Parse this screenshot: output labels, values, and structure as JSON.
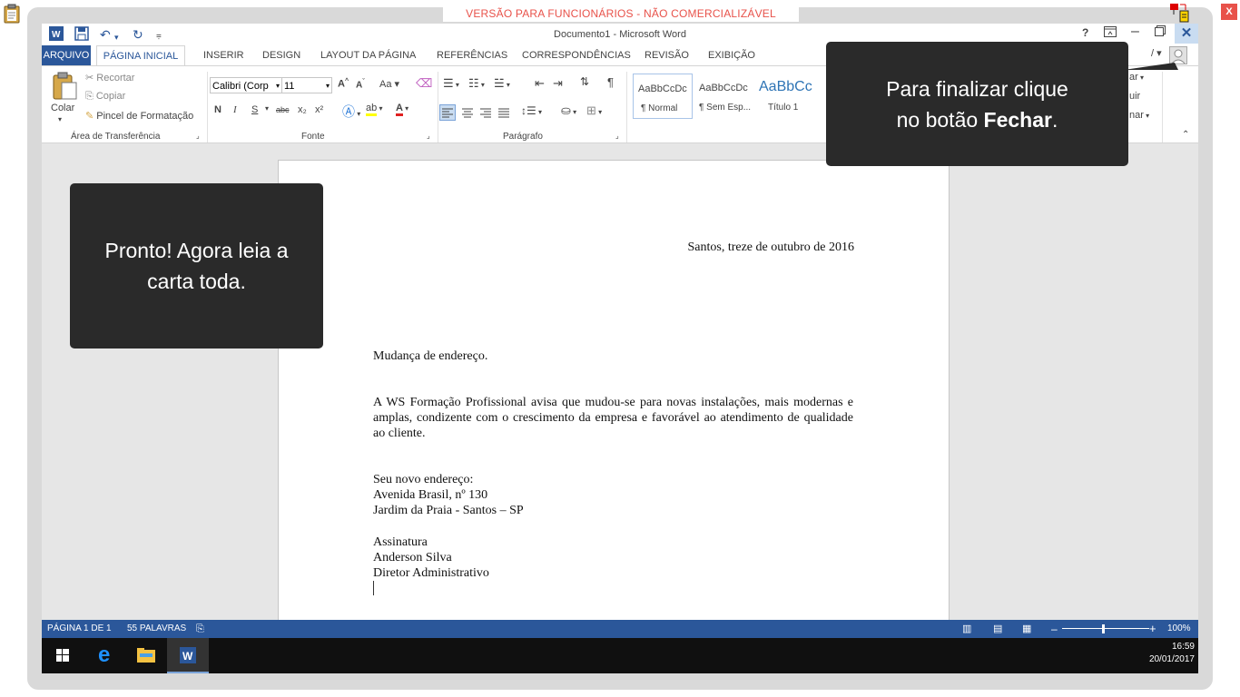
{
  "banner": {
    "text": "VERSÃO PARA FUNCIONÁRIOS - NÃO COMERCIALIZÁVEL",
    "close_x": "X",
    "color": "#e8524a"
  },
  "titlebar": {
    "title": "Documento1 - Microsoft Word",
    "help": "?",
    "minimize": "–",
    "close": "✕"
  },
  "tabs": [
    {
      "label": "ARQUIVO"
    },
    {
      "label": "PÁGINA INICIAL"
    },
    {
      "label": "INSERIR"
    },
    {
      "label": "DESIGN"
    },
    {
      "label": "LAYOUT DA PÁGINA"
    },
    {
      "label": "REFERÊNCIAS"
    },
    {
      "label": "CORRESPONDÊNCIAS"
    },
    {
      "label": "REVISÃO"
    },
    {
      "label": "EXIBIÇÃO"
    }
  ],
  "ribbon": {
    "clipboard": {
      "paste": "Colar",
      "cut": "Recortar",
      "copy": "Copiar",
      "format_painter": "Pincel de Formatação",
      "label": "Área de Transferência"
    },
    "font": {
      "name": "Calibri (Corp",
      "size": "11",
      "case": "Aa",
      "bold": "N",
      "italic": "I",
      "underline": "S",
      "strike": "abc",
      "sub": "x₂",
      "sup": "x²",
      "label": "Fonte"
    },
    "paragraph": {
      "label": "Parágrafo"
    },
    "styles": [
      {
        "preview": "AaBbCcDc",
        "name": "¶ Normal"
      },
      {
        "preview": "AaBbCcDc",
        "name": "¶ Sem Esp..."
      },
      {
        "preview": "AaBbCc",
        "name": "Título 1"
      }
    ],
    "editing_partial": [
      "ar",
      "uir",
      "nar"
    ]
  },
  "document": {
    "date_line": "Santos, treze de outubro de 2016",
    "subject": "Mudança de endereço.",
    "paragraph": "A WS Formação Profissional avisa que mudou-se para novas instalações, mais modernas e amplas, condizente com o crescimento da empresa e favorável ao atendimento de qualidade ao cliente.",
    "address_lines": [
      "Seu novo endereço:",
      "Avenida Brasil, nº 130",
      "Jardim da Praia - Santos – SP"
    ],
    "signature_lines": [
      "Assinatura",
      "Anderson Silva",
      "Diretor Administrativo"
    ]
  },
  "statusbar": {
    "page": "PÁGINA 1 DE 1",
    "words": "55 PALAVRAS",
    "zoom": "100%"
  },
  "taskbar": {
    "time": "16:59",
    "date": "20/01/2017"
  },
  "callouts": {
    "left_line1": "Pronto! Agora leia a",
    "left_line2": "carta toda.",
    "right_line1": "Para finalizar clique",
    "right_line2_pre": "no botão ",
    "right_line2_bold": "Fechar",
    "right_line2_post": "."
  }
}
